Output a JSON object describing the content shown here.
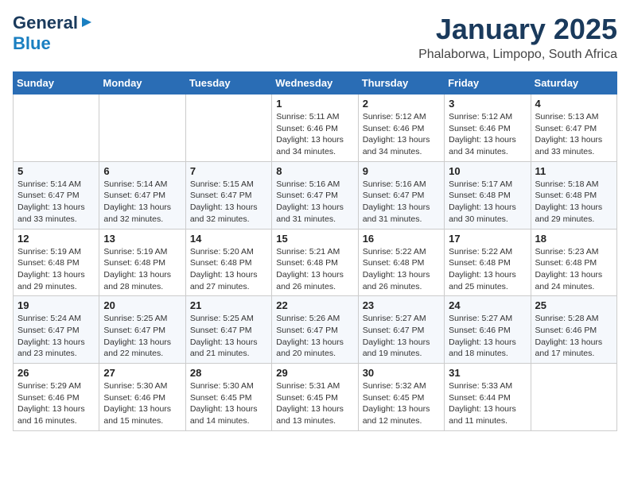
{
  "header": {
    "logo": {
      "line1": "General",
      "line2": "Blue"
    },
    "title": "January 2025",
    "location": "Phalaborwa, Limpopo, South Africa"
  },
  "days_of_week": [
    "Sunday",
    "Monday",
    "Tuesday",
    "Wednesday",
    "Thursday",
    "Friday",
    "Saturday"
  ],
  "weeks": [
    [
      {
        "day": "",
        "info": ""
      },
      {
        "day": "",
        "info": ""
      },
      {
        "day": "",
        "info": ""
      },
      {
        "day": "1",
        "info": "Sunrise: 5:11 AM\nSunset: 6:46 PM\nDaylight: 13 hours and 34 minutes."
      },
      {
        "day": "2",
        "info": "Sunrise: 5:12 AM\nSunset: 6:46 PM\nDaylight: 13 hours and 34 minutes."
      },
      {
        "day": "3",
        "info": "Sunrise: 5:12 AM\nSunset: 6:46 PM\nDaylight: 13 hours and 34 minutes."
      },
      {
        "day": "4",
        "info": "Sunrise: 5:13 AM\nSunset: 6:47 PM\nDaylight: 13 hours and 33 minutes."
      }
    ],
    [
      {
        "day": "5",
        "info": "Sunrise: 5:14 AM\nSunset: 6:47 PM\nDaylight: 13 hours and 33 minutes."
      },
      {
        "day": "6",
        "info": "Sunrise: 5:14 AM\nSunset: 6:47 PM\nDaylight: 13 hours and 32 minutes."
      },
      {
        "day": "7",
        "info": "Sunrise: 5:15 AM\nSunset: 6:47 PM\nDaylight: 13 hours and 32 minutes."
      },
      {
        "day": "8",
        "info": "Sunrise: 5:16 AM\nSunset: 6:47 PM\nDaylight: 13 hours and 31 minutes."
      },
      {
        "day": "9",
        "info": "Sunrise: 5:16 AM\nSunset: 6:47 PM\nDaylight: 13 hours and 31 minutes."
      },
      {
        "day": "10",
        "info": "Sunrise: 5:17 AM\nSunset: 6:48 PM\nDaylight: 13 hours and 30 minutes."
      },
      {
        "day": "11",
        "info": "Sunrise: 5:18 AM\nSunset: 6:48 PM\nDaylight: 13 hours and 29 minutes."
      }
    ],
    [
      {
        "day": "12",
        "info": "Sunrise: 5:19 AM\nSunset: 6:48 PM\nDaylight: 13 hours and 29 minutes."
      },
      {
        "day": "13",
        "info": "Sunrise: 5:19 AM\nSunset: 6:48 PM\nDaylight: 13 hours and 28 minutes."
      },
      {
        "day": "14",
        "info": "Sunrise: 5:20 AM\nSunset: 6:48 PM\nDaylight: 13 hours and 27 minutes."
      },
      {
        "day": "15",
        "info": "Sunrise: 5:21 AM\nSunset: 6:48 PM\nDaylight: 13 hours and 26 minutes."
      },
      {
        "day": "16",
        "info": "Sunrise: 5:22 AM\nSunset: 6:48 PM\nDaylight: 13 hours and 26 minutes."
      },
      {
        "day": "17",
        "info": "Sunrise: 5:22 AM\nSunset: 6:48 PM\nDaylight: 13 hours and 25 minutes."
      },
      {
        "day": "18",
        "info": "Sunrise: 5:23 AM\nSunset: 6:48 PM\nDaylight: 13 hours and 24 minutes."
      }
    ],
    [
      {
        "day": "19",
        "info": "Sunrise: 5:24 AM\nSunset: 6:47 PM\nDaylight: 13 hours and 23 minutes."
      },
      {
        "day": "20",
        "info": "Sunrise: 5:25 AM\nSunset: 6:47 PM\nDaylight: 13 hours and 22 minutes."
      },
      {
        "day": "21",
        "info": "Sunrise: 5:25 AM\nSunset: 6:47 PM\nDaylight: 13 hours and 21 minutes."
      },
      {
        "day": "22",
        "info": "Sunrise: 5:26 AM\nSunset: 6:47 PM\nDaylight: 13 hours and 20 minutes."
      },
      {
        "day": "23",
        "info": "Sunrise: 5:27 AM\nSunset: 6:47 PM\nDaylight: 13 hours and 19 minutes."
      },
      {
        "day": "24",
        "info": "Sunrise: 5:27 AM\nSunset: 6:46 PM\nDaylight: 13 hours and 18 minutes."
      },
      {
        "day": "25",
        "info": "Sunrise: 5:28 AM\nSunset: 6:46 PM\nDaylight: 13 hours and 17 minutes."
      }
    ],
    [
      {
        "day": "26",
        "info": "Sunrise: 5:29 AM\nSunset: 6:46 PM\nDaylight: 13 hours and 16 minutes."
      },
      {
        "day": "27",
        "info": "Sunrise: 5:30 AM\nSunset: 6:46 PM\nDaylight: 13 hours and 15 minutes."
      },
      {
        "day": "28",
        "info": "Sunrise: 5:30 AM\nSunset: 6:45 PM\nDaylight: 13 hours and 14 minutes."
      },
      {
        "day": "29",
        "info": "Sunrise: 5:31 AM\nSunset: 6:45 PM\nDaylight: 13 hours and 13 minutes."
      },
      {
        "day": "30",
        "info": "Sunrise: 5:32 AM\nSunset: 6:45 PM\nDaylight: 13 hours and 12 minutes."
      },
      {
        "day": "31",
        "info": "Sunrise: 5:33 AM\nSunset: 6:44 PM\nDaylight: 13 hours and 11 minutes."
      },
      {
        "day": "",
        "info": ""
      }
    ]
  ]
}
